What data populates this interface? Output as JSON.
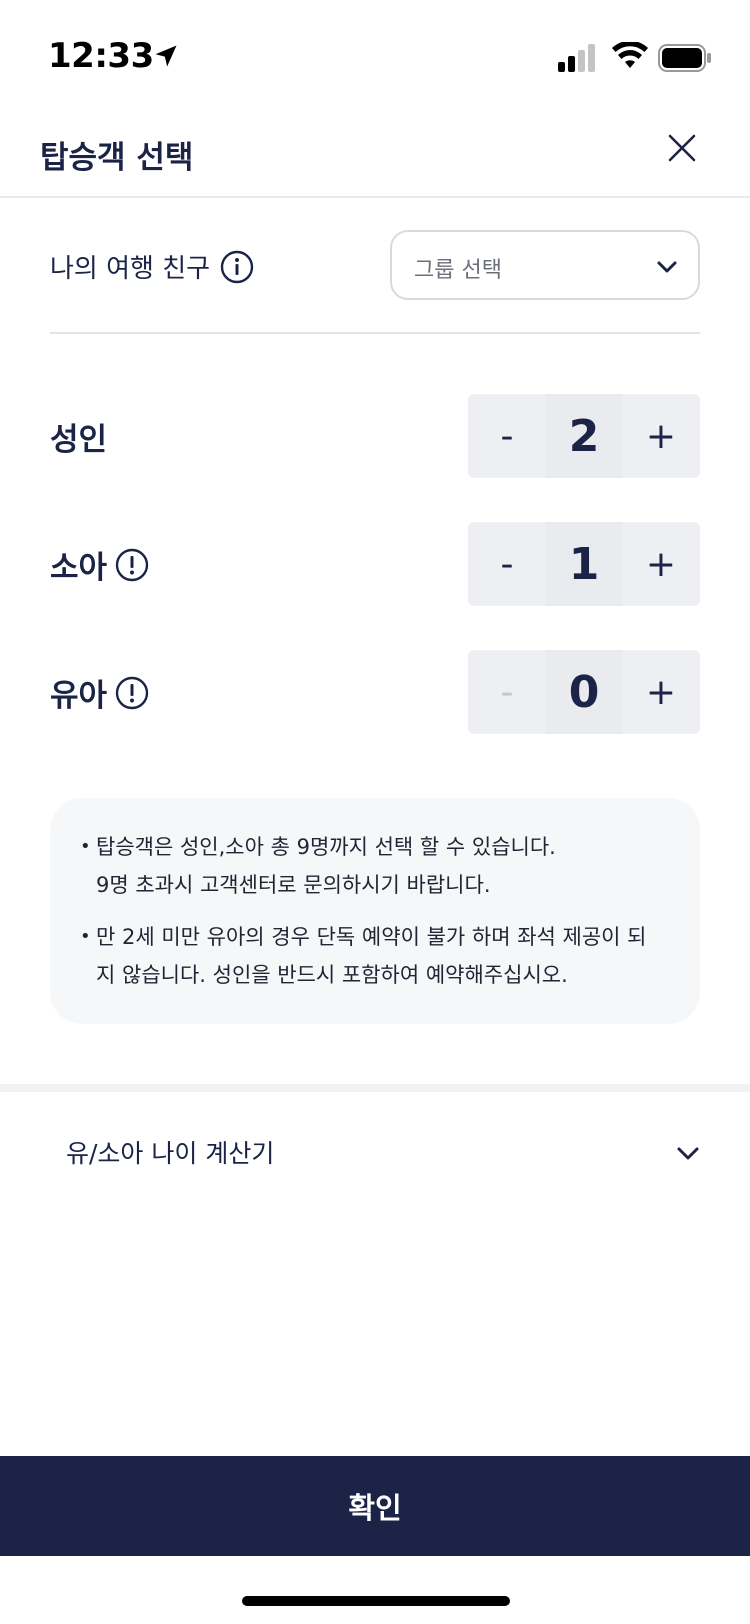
{
  "status_bar": {
    "time": "12:33"
  },
  "header": {
    "title": "탑승객 선택",
    "close_icon": "close-icon"
  },
  "travel_friend": {
    "label": "나의 여행 친구",
    "select_label": "그룹 선택"
  },
  "passengers": [
    {
      "key": "adult",
      "label": "성인",
      "count": "2",
      "minus": "-",
      "plus": "+",
      "has_alert": false,
      "minus_disabled": false
    },
    {
      "key": "child",
      "label": "소아",
      "count": "1",
      "minus": "-",
      "plus": "+",
      "has_alert": true,
      "minus_disabled": false
    },
    {
      "key": "infant",
      "label": "유아",
      "count": "0",
      "minus": "-",
      "plus": "+",
      "has_alert": true,
      "minus_disabled": true
    }
  ],
  "notices": [
    "탑승객은 성인,소아 총 9명까지 선택 할 수 있습니다.\n9명 초과시 고객센터로 문의하시기 바랍니다.",
    "만 2세 미만 유아의 경우 단독 예약이 불가 하며 좌석 제공이 되\n지 않습니다. 성인을 반드시 포함하여 예약해주십시오."
  ],
  "age_calculator": {
    "label": "유/소아 나이 계산기"
  },
  "confirm": {
    "label": "확인"
  },
  "colors": {
    "primary": "#1b2446",
    "stepper_bg": "#eeeff2",
    "notice_bg": "#f6f7f9",
    "disabled": "#c3c6cf"
  }
}
